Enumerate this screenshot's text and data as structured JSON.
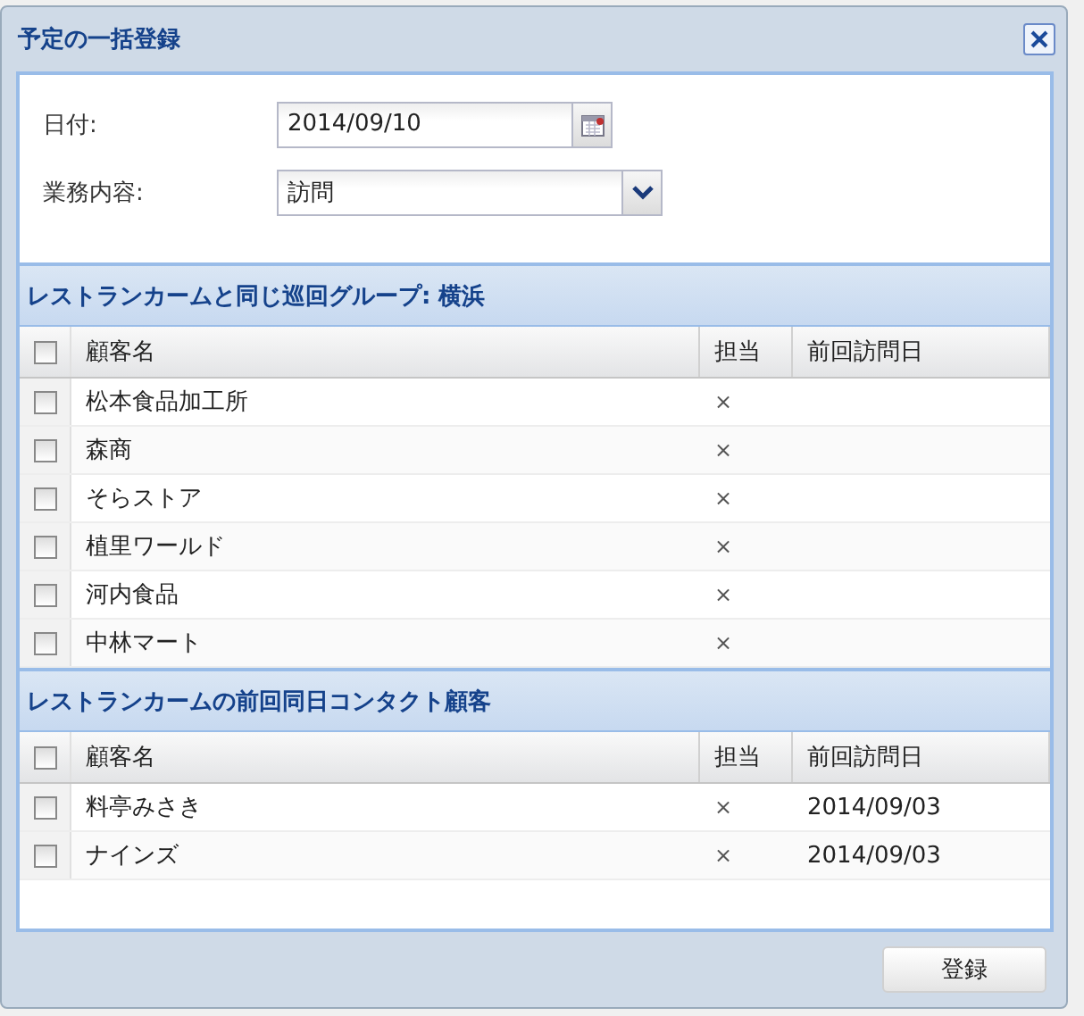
{
  "window": {
    "title": "予定の一括登録"
  },
  "form": [
    {
      "kind": "date",
      "label": "日付:",
      "value": "2014/09/10"
    },
    {
      "kind": "select",
      "label": "業務内容:",
      "value": "訪問"
    }
  ],
  "sections": [
    {
      "title": "レストランカームと同じ巡回グループ: 横浜",
      "columns": [
        "顧客名",
        "担当",
        "前回訪問日"
      ],
      "all_checked": false,
      "rows": [
        {
          "checked": false,
          "name": "松本食品加工所",
          "owner": "×"
        },
        {
          "checked": false,
          "name": "森商",
          "owner": "×"
        },
        {
          "checked": false,
          "name": "そらストア",
          "owner": "×"
        },
        {
          "checked": false,
          "name": "植里ワールド",
          "owner": "×"
        },
        {
          "checked": false,
          "name": "河内食品",
          "owner": "×"
        },
        {
          "checked": false,
          "name": "中林マート",
          "owner": "×"
        }
      ]
    },
    {
      "title": "レストランカームの前回同日コンタクト顧客",
      "columns": [
        "顧客名",
        "担当",
        "前回訪問日"
      ],
      "all_checked": false,
      "rows": [
        {
          "checked": false,
          "name": "料亭みさき",
          "owner": "×",
          "last_visit": "2014/09/03"
        },
        {
          "checked": false,
          "name": "ナインズ",
          "owner": "×",
          "last_visit": "2014/09/03"
        }
      ]
    }
  ],
  "buttons": [
    "登録"
  ]
}
